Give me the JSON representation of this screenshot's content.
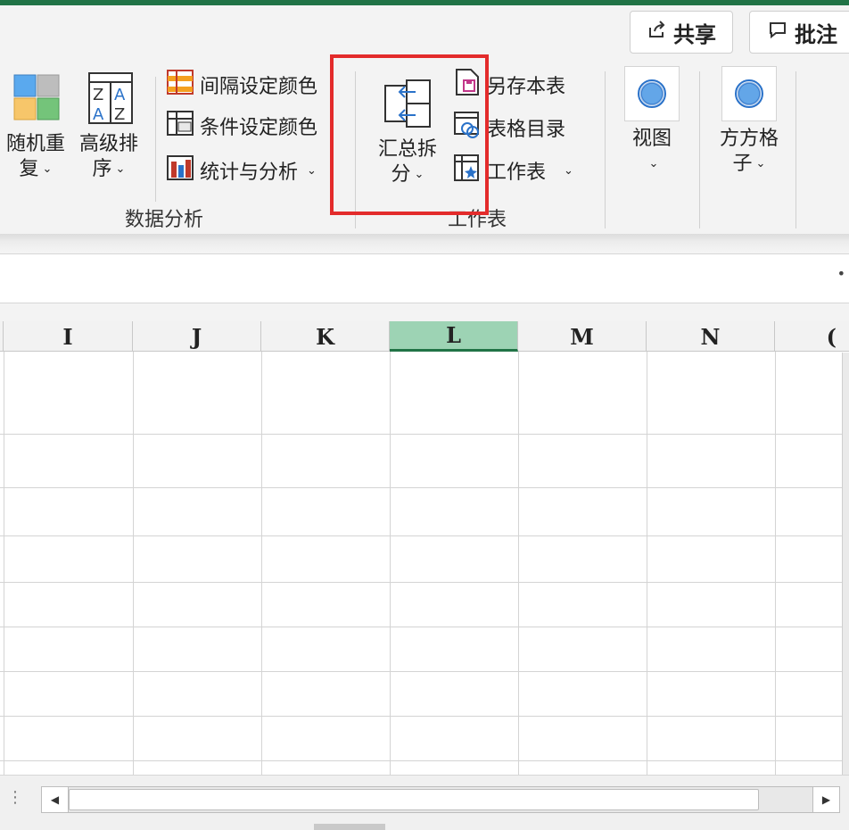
{
  "header": {
    "share_label": "共享",
    "comment_label": "批注"
  },
  "ribbon": {
    "data_analysis_group": {
      "label": "数据分析",
      "random_repeat_label": "随机重\n复",
      "advanced_sort_label": "高级排\n序",
      "interval_color_label": "间隔设定颜色",
      "condition_color_label": "条件设定颜色",
      "stats_analysis_label": "统计与分析"
    },
    "worksheet_group": {
      "label": "工作表",
      "summary_split_label": "汇总拆\n分",
      "save_sheet_label": "另存本表",
      "table_directory_label": "表格目录",
      "worksheet_label": "工作表"
    },
    "view_label": "视图",
    "grid_label": "方方格\n子"
  },
  "sheet": {
    "columns": [
      "I",
      "J",
      "K",
      "L",
      "M",
      "N",
      "("
    ],
    "selected_column": "L"
  },
  "colors": {
    "accent": "#217346",
    "selected_header": "#9dd3b4",
    "highlight_box": "#e32b2b"
  },
  "icons": [
    "share-icon",
    "comment-icon",
    "random-repeat-icon",
    "advanced-sort-icon",
    "interval-color-icon",
    "condition-color-icon",
    "stats-analysis-icon",
    "summary-split-icon",
    "save-sheet-icon",
    "table-directory-icon",
    "worksheet-icon",
    "view-icon",
    "grid-icon",
    "chevron-down-icon"
  ]
}
